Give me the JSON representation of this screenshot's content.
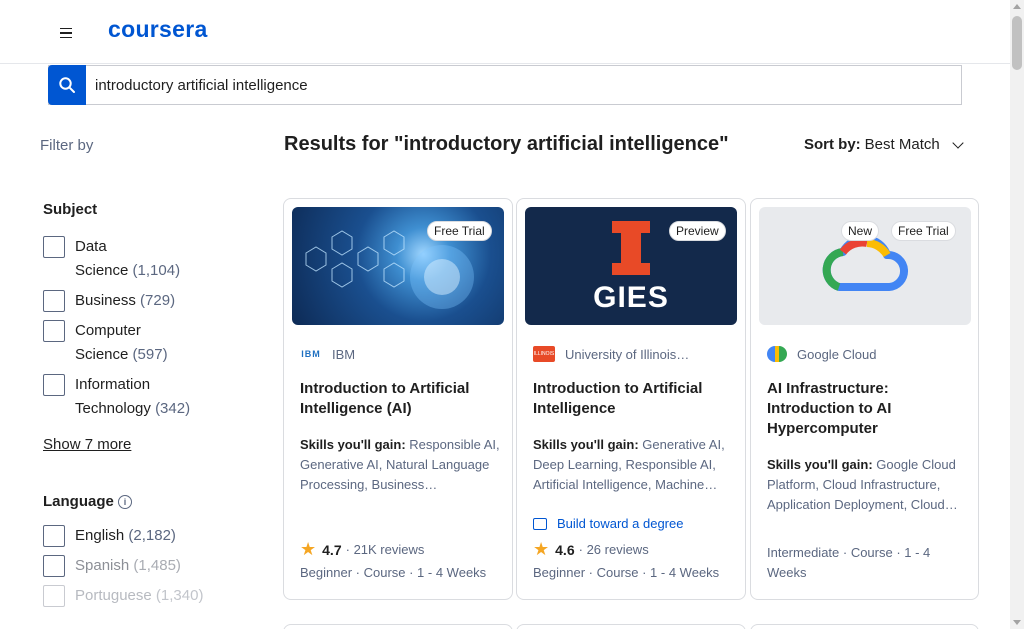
{
  "header": {
    "logo_text": "coursera",
    "menu_icon": "hamburger-icon"
  },
  "search": {
    "value": "introductory artificial intelligence",
    "icon": "search-icon"
  },
  "filters": {
    "filter_by_label": "Filter by",
    "subject": {
      "title": "Subject",
      "options": [
        {
          "label_1": "Data",
          "label_2": "Science",
          "count": "(1,104)"
        },
        {
          "label_1": "Business",
          "label_2": "",
          "count": "(729)"
        },
        {
          "label_1": "Computer",
          "label_2": "Science",
          "count": "(597)"
        },
        {
          "label_1": "Information",
          "label_2": "Technology",
          "count": "(342)"
        }
      ],
      "show_more": "Show 7 more"
    },
    "language": {
      "title": "Language",
      "options": [
        {
          "label": "English",
          "count": "(2,182)"
        },
        {
          "label": "Spanish",
          "count": "(1,485)"
        },
        {
          "label": "Portuguese",
          "count": "(1,340)"
        }
      ]
    }
  },
  "results": {
    "title": "Results for \"introductory artificial intelligence\"",
    "sort_label": "Sort by:",
    "sort_value": "Best Match"
  },
  "cards": [
    {
      "badges": [
        "Free Trial"
      ],
      "partner_logo_text": "IBM",
      "partner": "IBM",
      "title": "Introduction to Artificial Intelligence (AI)",
      "skills_label": "Skills you'll gain:",
      "skills": "Responsible AI, Generative AI, Natural Language Processing, Business…",
      "rating": "4.7",
      "reviews": "21K reviews",
      "meta": "Beginner · Course · 1 - 4 Weeks"
    },
    {
      "badges": [
        "Preview"
      ],
      "thumb_text": "GIES",
      "partner_logo_text": "ILLINOIS",
      "partner": "University of Illinois…",
      "title": "Introduction to Artificial Intelligence",
      "skills_label": "Skills you'll gain:",
      "skills": "Generative AI, Deep Learning, Responsible AI, Artificial Intelligence, Machine…",
      "degree_link": "Build toward a degree",
      "rating": "4.6",
      "reviews": "26 reviews",
      "meta": "Beginner · Course · 1 - 4 Weeks"
    },
    {
      "badges": [
        "New",
        "Free Trial"
      ],
      "partner": "Google Cloud",
      "title": "AI Infrastructure: Introduction to AI Hypercomputer",
      "skills_label": "Skills you'll gain:",
      "skills": "Google Cloud Platform, Cloud Infrastructure, Application Deployment, Cloud…",
      "meta": "Intermediate · Course · 1 - 4 Weeks"
    }
  ],
  "colors": {
    "brand": "#0056d2",
    "text": "#1f1f1f",
    "muted": "#5b6780",
    "illinois_orange": "#e84a27",
    "illinois_navy": "#13294b"
  }
}
